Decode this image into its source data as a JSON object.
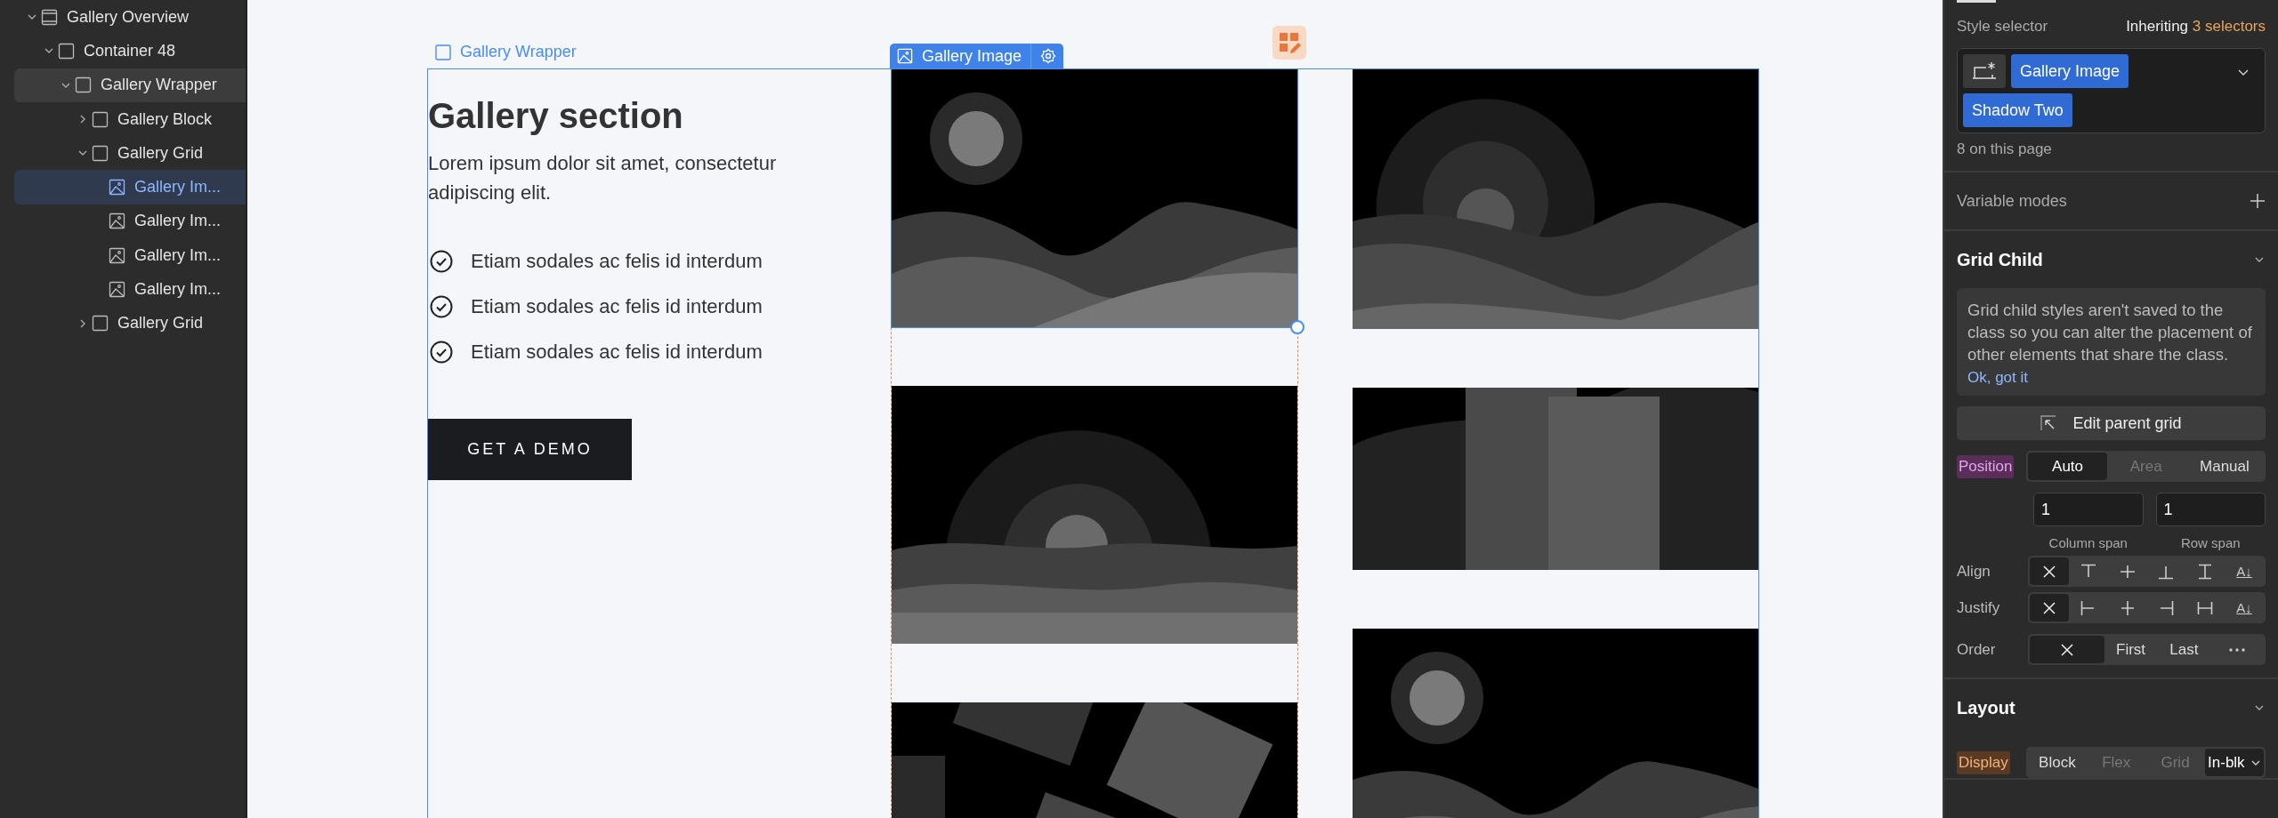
{
  "navigator": {
    "tree": [
      {
        "label": "Gallery Overview",
        "kind": "section",
        "expanded": true,
        "hovered": false,
        "selected": false,
        "children": [
          {
            "label": "Container 48",
            "kind": "box",
            "expanded": true,
            "hovered": false,
            "selected": false,
            "children": [
              {
                "label": "Gallery Wrapper",
                "kind": "box",
                "expanded": true,
                "hovered": true,
                "selected": false,
                "children": [
                  {
                    "label": "Gallery Block",
                    "kind": "box",
                    "expanded": false,
                    "hovered": false,
                    "selected": false
                  },
                  {
                    "label": "Gallery Grid",
                    "kind": "box",
                    "expanded": true,
                    "hovered": false,
                    "selected": false,
                    "children": [
                      {
                        "label": "Gallery Im...",
                        "kind": "image",
                        "hovered": false,
                        "selected": true
                      },
                      {
                        "label": "Gallery Im...",
                        "kind": "image",
                        "hovered": false,
                        "selected": false
                      },
                      {
                        "label": "Gallery Im...",
                        "kind": "image",
                        "hovered": false,
                        "selected": false
                      },
                      {
                        "label": "Gallery Im...",
                        "kind": "image",
                        "hovered": false,
                        "selected": false
                      }
                    ]
                  },
                  {
                    "label": "Gallery Grid",
                    "kind": "box",
                    "expanded": false,
                    "hovered": false,
                    "selected": false
                  }
                ]
              }
            ]
          }
        ]
      }
    ]
  },
  "canvas": {
    "wrapper_label": "Gallery Wrapper",
    "heading": "Gallery section",
    "intro": "Lorem ipsum dolor sit amet, consectetur adipiscing elit.",
    "features": [
      "Etiam sodales ac felis id interdum",
      "Etiam sodales ac felis id interdum",
      "Etiam sodales ac felis id interdum"
    ],
    "cta": "GET A DEMO",
    "selected_label": "Gallery Image",
    "columns": [
      [
        {
          "kind": "sun-hills",
          "selected": true
        },
        {
          "kind": "sun-waves",
          "selected": false
        },
        {
          "kind": "tilted-squares",
          "selected": false
        }
      ],
      [
        {
          "kind": "eclipse-hills",
          "selected": false
        },
        {
          "kind": "blocks",
          "selected": false
        },
        {
          "kind": "sun-hills",
          "selected": false
        }
      ]
    ]
  },
  "style_panel": {
    "style_selector_label": "Style selector",
    "inheriting": "Inheriting",
    "inheriting_count": "3 selectors",
    "selectors": [
      "Gallery Image",
      "Shadow Two"
    ],
    "usage": "8 on this page",
    "variable_modes": "Variable modes",
    "grid_child": {
      "title": "Grid Child",
      "expanded": true,
      "note": "Grid child styles aren't saved to the class so you can alter the placement of other elements that share the class.",
      "note_link": "Ok, got it",
      "edit_button": "Edit parent grid",
      "position": {
        "label": "Position",
        "kind": "local",
        "options": [
          {
            "label": "Auto",
            "selected": true,
            "disabled": false
          },
          {
            "label": "Area",
            "selected": false,
            "disabled": true
          },
          {
            "label": "Manual",
            "selected": false,
            "disabled": false
          }
        ]
      },
      "spans": [
        {
          "value": "1",
          "caption": "Column span"
        },
        {
          "value": "1",
          "caption": "Row span"
        }
      ],
      "align": {
        "label": "Align",
        "options": [
          {
            "kind": "none",
            "selected": true
          },
          {
            "kind": "start",
            "selected": false
          },
          {
            "kind": "center",
            "selected": false
          },
          {
            "kind": "end",
            "selected": false
          },
          {
            "kind": "stretch",
            "selected": false
          },
          {
            "kind": "baseline",
            "label": "A↓",
            "selected": false
          }
        ]
      },
      "justify": {
        "label": "Justify",
        "options": [
          {
            "kind": "none",
            "selected": true
          },
          {
            "kind": "start",
            "selected": false
          },
          {
            "kind": "center",
            "selected": false
          },
          {
            "kind": "end",
            "selected": false
          },
          {
            "kind": "stretch",
            "selected": false
          },
          {
            "kind": "baseline",
            "label": "A↓",
            "selected": false
          }
        ]
      },
      "order": {
        "label": "Order",
        "options": [
          {
            "kind": "none",
            "selected": true
          },
          {
            "kind": "text",
            "label": "First",
            "selected": false
          },
          {
            "kind": "text",
            "label": "Last",
            "selected": false
          },
          {
            "kind": "more",
            "selected": false
          }
        ]
      }
    },
    "layout": {
      "title": "Layout",
      "expanded": true,
      "display": {
        "label": "Display",
        "kind": "inherited",
        "options": [
          {
            "label": "Block",
            "selected": false,
            "disabled": false,
            "dropdown": false
          },
          {
            "label": "Flex",
            "selected": false,
            "disabled": true,
            "dropdown": false
          },
          {
            "label": "Grid",
            "selected": false,
            "disabled": true,
            "dropdown": false
          },
          {
            "label": "In-blk",
            "selected": true,
            "disabled": false,
            "dropdown": true
          }
        ]
      }
    }
  }
}
